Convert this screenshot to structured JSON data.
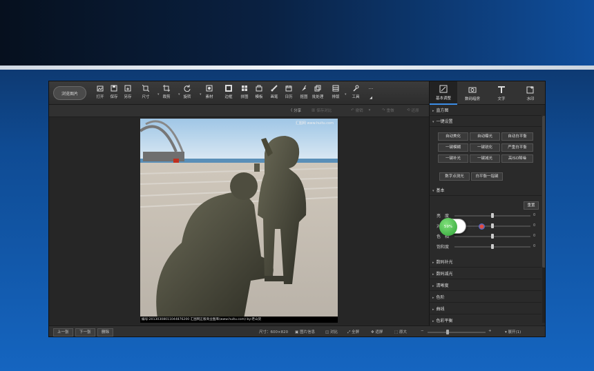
{
  "toolbar": {
    "browse": "浏览图片",
    "tools": [
      {
        "label": "打开",
        "icon": "open-image-icon"
      },
      {
        "label": "保存",
        "icon": "save-icon"
      },
      {
        "label": "另存",
        "icon": "save-as-icon"
      },
      {
        "label": "尺寸",
        "icon": "resize-icon"
      },
      {
        "label": "裁剪",
        "icon": "crop-icon"
      },
      {
        "label": "旋转",
        "icon": "rotate-icon"
      },
      {
        "label": "素材",
        "icon": "material-icon"
      },
      {
        "label": "边框",
        "icon": "border-icon"
      },
      {
        "label": "拼图",
        "icon": "collage-icon"
      },
      {
        "label": "模板",
        "icon": "template-icon"
      },
      {
        "label": "画笔",
        "icon": "brush-icon"
      },
      {
        "label": "日历",
        "icon": "calendar-icon"
      },
      {
        "label": "抠图",
        "icon": "cutout-icon"
      },
      {
        "label": "批处理",
        "icon": "batch-icon"
      },
      {
        "label": "排版",
        "icon": "layout-icon"
      },
      {
        "label": "工具",
        "icon": "tools-icon"
      }
    ],
    "more": "···"
  },
  "subbar": {
    "share": "分享",
    "save_compare": "保存对比",
    "undo": "撤销",
    "redo": "重做",
    "restore": "还原"
  },
  "photo": {
    "watermark": "汇图网 www.huitu.com",
    "caption": "编号:20130308011044876200   汇图网正版商业图库(www.huitu.com)  by:老山货"
  },
  "statusbar": {
    "prev": "上一张",
    "next": "下一张",
    "delete": "删除",
    "size": "尺寸：600×820",
    "image_info": "图片信息",
    "compare": "对比",
    "fullscreen": "全屏",
    "fit": "适屏",
    "original": "原大",
    "minus": "−",
    "plus": "+",
    "expand": "▾ 展开(1)",
    "zoom_fraction": 0.35
  },
  "right_tabs": [
    {
      "label": "基本调整",
      "icon": "basic-adjust-icon",
      "active": true
    },
    {
      "label": "数码暗房",
      "icon": "darkroom-camera-icon",
      "active": false
    },
    {
      "label": "文字",
      "icon": "text-icon",
      "active": false
    },
    {
      "label": "水印",
      "icon": "watermark-icon",
      "active": false
    }
  ],
  "sections": {
    "histogram": "直方图",
    "one_click": "一键设置",
    "basic": "基本",
    "digital_fill": "数码补光",
    "digital_reduce": "数码减光",
    "sharpness": "清晰度",
    "levels": "色阶",
    "curves": "曲线",
    "color_balance": "色彩平衡"
  },
  "one_click_buttons": [
    "自动美化",
    "自动曝光",
    "自动白平衡",
    "一键模糊",
    "一键锐化",
    "严重白平衡",
    "一键补光",
    "一键减光",
    "高ISO降噪",
    "数字点测光",
    "白平衡一指键"
  ],
  "basic": {
    "reset": "重置",
    "rows": [
      {
        "label": "亮　度",
        "value": "0",
        "fraction": 0.5
      },
      {
        "label": "对比度",
        "value": "0",
        "fraction": 0.5
      },
      {
        "label": "色　相",
        "value": "0",
        "fraction": 0.5
      },
      {
        "label": "饱和度",
        "value": "0",
        "fraction": 0.5
      }
    ]
  },
  "widget": {
    "percent": "59%",
    "up": "0K/s",
    "down": "0K/s"
  }
}
